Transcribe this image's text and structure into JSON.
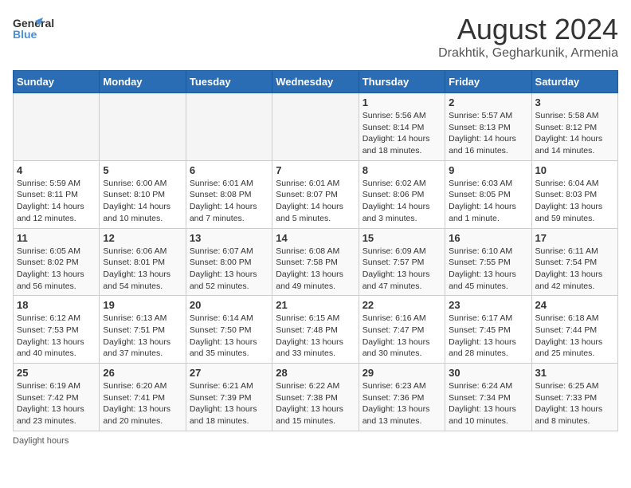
{
  "header": {
    "logo_line1": "General",
    "logo_line2": "Blue",
    "main_title": "August 2024",
    "sub_title": "Drakhtik, Gegharkunik, Armenia"
  },
  "days_of_week": [
    "Sunday",
    "Monday",
    "Tuesday",
    "Wednesday",
    "Thursday",
    "Friday",
    "Saturday"
  ],
  "weeks": [
    [
      {
        "day": "",
        "info": ""
      },
      {
        "day": "",
        "info": ""
      },
      {
        "day": "",
        "info": ""
      },
      {
        "day": "",
        "info": ""
      },
      {
        "day": "1",
        "info": "Sunrise: 5:56 AM\nSunset: 8:14 PM\nDaylight: 14 hours\nand 18 minutes."
      },
      {
        "day": "2",
        "info": "Sunrise: 5:57 AM\nSunset: 8:13 PM\nDaylight: 14 hours\nand 16 minutes."
      },
      {
        "day": "3",
        "info": "Sunrise: 5:58 AM\nSunset: 8:12 PM\nDaylight: 14 hours\nand 14 minutes."
      }
    ],
    [
      {
        "day": "4",
        "info": "Sunrise: 5:59 AM\nSunset: 8:11 PM\nDaylight: 14 hours\nand 12 minutes."
      },
      {
        "day": "5",
        "info": "Sunrise: 6:00 AM\nSunset: 8:10 PM\nDaylight: 14 hours\nand 10 minutes."
      },
      {
        "day": "6",
        "info": "Sunrise: 6:01 AM\nSunset: 8:08 PM\nDaylight: 14 hours\nand 7 minutes."
      },
      {
        "day": "7",
        "info": "Sunrise: 6:01 AM\nSunset: 8:07 PM\nDaylight: 14 hours\nand 5 minutes."
      },
      {
        "day": "8",
        "info": "Sunrise: 6:02 AM\nSunset: 8:06 PM\nDaylight: 14 hours\nand 3 minutes."
      },
      {
        "day": "9",
        "info": "Sunrise: 6:03 AM\nSunset: 8:05 PM\nDaylight: 14 hours\nand 1 minute."
      },
      {
        "day": "10",
        "info": "Sunrise: 6:04 AM\nSunset: 8:03 PM\nDaylight: 13 hours\nand 59 minutes."
      }
    ],
    [
      {
        "day": "11",
        "info": "Sunrise: 6:05 AM\nSunset: 8:02 PM\nDaylight: 13 hours\nand 56 minutes."
      },
      {
        "day": "12",
        "info": "Sunrise: 6:06 AM\nSunset: 8:01 PM\nDaylight: 13 hours\nand 54 minutes."
      },
      {
        "day": "13",
        "info": "Sunrise: 6:07 AM\nSunset: 8:00 PM\nDaylight: 13 hours\nand 52 minutes."
      },
      {
        "day": "14",
        "info": "Sunrise: 6:08 AM\nSunset: 7:58 PM\nDaylight: 13 hours\nand 49 minutes."
      },
      {
        "day": "15",
        "info": "Sunrise: 6:09 AM\nSunset: 7:57 PM\nDaylight: 13 hours\nand 47 minutes."
      },
      {
        "day": "16",
        "info": "Sunrise: 6:10 AM\nSunset: 7:55 PM\nDaylight: 13 hours\nand 45 minutes."
      },
      {
        "day": "17",
        "info": "Sunrise: 6:11 AM\nSunset: 7:54 PM\nDaylight: 13 hours\nand 42 minutes."
      }
    ],
    [
      {
        "day": "18",
        "info": "Sunrise: 6:12 AM\nSunset: 7:53 PM\nDaylight: 13 hours\nand 40 minutes."
      },
      {
        "day": "19",
        "info": "Sunrise: 6:13 AM\nSunset: 7:51 PM\nDaylight: 13 hours\nand 37 minutes."
      },
      {
        "day": "20",
        "info": "Sunrise: 6:14 AM\nSunset: 7:50 PM\nDaylight: 13 hours\nand 35 minutes."
      },
      {
        "day": "21",
        "info": "Sunrise: 6:15 AM\nSunset: 7:48 PM\nDaylight: 13 hours\nand 33 minutes."
      },
      {
        "day": "22",
        "info": "Sunrise: 6:16 AM\nSunset: 7:47 PM\nDaylight: 13 hours\nand 30 minutes."
      },
      {
        "day": "23",
        "info": "Sunrise: 6:17 AM\nSunset: 7:45 PM\nDaylight: 13 hours\nand 28 minutes."
      },
      {
        "day": "24",
        "info": "Sunrise: 6:18 AM\nSunset: 7:44 PM\nDaylight: 13 hours\nand 25 minutes."
      }
    ],
    [
      {
        "day": "25",
        "info": "Sunrise: 6:19 AM\nSunset: 7:42 PM\nDaylight: 13 hours\nand 23 minutes."
      },
      {
        "day": "26",
        "info": "Sunrise: 6:20 AM\nSunset: 7:41 PM\nDaylight: 13 hours\nand 20 minutes."
      },
      {
        "day": "27",
        "info": "Sunrise: 6:21 AM\nSunset: 7:39 PM\nDaylight: 13 hours\nand 18 minutes."
      },
      {
        "day": "28",
        "info": "Sunrise: 6:22 AM\nSunset: 7:38 PM\nDaylight: 13 hours\nand 15 minutes."
      },
      {
        "day": "29",
        "info": "Sunrise: 6:23 AM\nSunset: 7:36 PM\nDaylight: 13 hours\nand 13 minutes."
      },
      {
        "day": "30",
        "info": "Sunrise: 6:24 AM\nSunset: 7:34 PM\nDaylight: 13 hours\nand 10 minutes."
      },
      {
        "day": "31",
        "info": "Sunrise: 6:25 AM\nSunset: 7:33 PM\nDaylight: 13 hours\nand 8 minutes."
      }
    ]
  ],
  "footer": {
    "note": "Daylight hours"
  }
}
